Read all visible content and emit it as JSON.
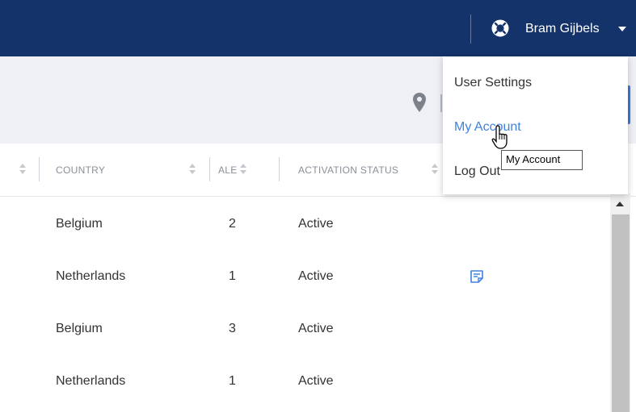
{
  "topbar": {
    "user_name": "Bram Gijbels",
    "icons": {
      "help": "lifebuoy-icon",
      "menu": "caret-down-icon"
    }
  },
  "subheader": {
    "icons": {
      "location": "map-pin-icon"
    }
  },
  "table": {
    "columns": [
      "COUNTRY",
      "ALERTS",
      "ACTIVATION STATUS"
    ],
    "rows": [
      {
        "country": "Belgium",
        "alerts": "2",
        "status": "Active",
        "has_note": false
      },
      {
        "country": "Netherlands",
        "alerts": "1",
        "status": "Active",
        "has_note": true
      },
      {
        "country": "Belgium",
        "alerts": "3",
        "status": "Active",
        "has_note": false
      },
      {
        "country": "Netherlands",
        "alerts": "1",
        "status": "Active",
        "has_note": false
      }
    ]
  },
  "user_menu": {
    "items": [
      "User Settings",
      "My Account",
      "Log Out"
    ],
    "hovered": "My Account"
  },
  "tooltip": {
    "text": "My Account"
  },
  "colors": {
    "topbar": "#14336b",
    "subheader": "#eef0f5",
    "link_hover": "#3f82e0",
    "accent": "#3a7bd5"
  }
}
